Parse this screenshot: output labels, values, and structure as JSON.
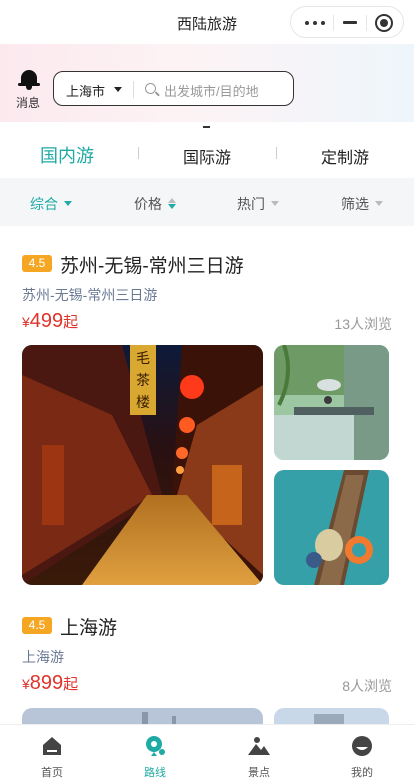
{
  "app": {
    "title": "西陆旅游"
  },
  "header": {
    "message_label": "消息",
    "city": "上海市",
    "search_placeholder": "出发城市/目的地"
  },
  "category_tabs": [
    {
      "label": "国内游",
      "active": true
    },
    {
      "label": "国际游",
      "active": false
    },
    {
      "label": "定制游",
      "active": false
    }
  ],
  "sort_bar": [
    {
      "label": "综合",
      "active": true
    },
    {
      "label": "价格",
      "active": false
    },
    {
      "label": "热门",
      "active": false
    },
    {
      "label": "筛选",
      "active": false
    }
  ],
  "products": [
    {
      "rating": "4.5",
      "title": "苏州-无锡-常州三日游",
      "subtitle": "苏州-无锡-常州三日游",
      "price_symbol": "¥",
      "price": "499",
      "price_suffix": "起",
      "views": "13人浏览",
      "images": [
        "night-alley-red-lanterns-photo",
        "canal-willow-bridge-photo",
        "boat-on-teal-water-photo"
      ]
    },
    {
      "rating": "4.5",
      "title": "上海游",
      "subtitle": "上海游",
      "price_symbol": "¥",
      "price": "899",
      "price_suffix": "起",
      "views": "8人浏览",
      "images": [
        "shanghai-skyline-photo",
        "shanghai-side-photo"
      ]
    }
  ],
  "bottom_tabs": [
    {
      "label": "首页",
      "icon": "home-icon",
      "active": false
    },
    {
      "label": "路线",
      "icon": "route-pin-icon",
      "active": true
    },
    {
      "label": "景点",
      "icon": "mountain-icon",
      "active": false
    },
    {
      "label": "我的",
      "icon": "profile-icon",
      "active": false
    }
  ],
  "colors": {
    "accent": "#1faaa5",
    "price": "#e0332a",
    "rating_badge": "#f5a623"
  }
}
